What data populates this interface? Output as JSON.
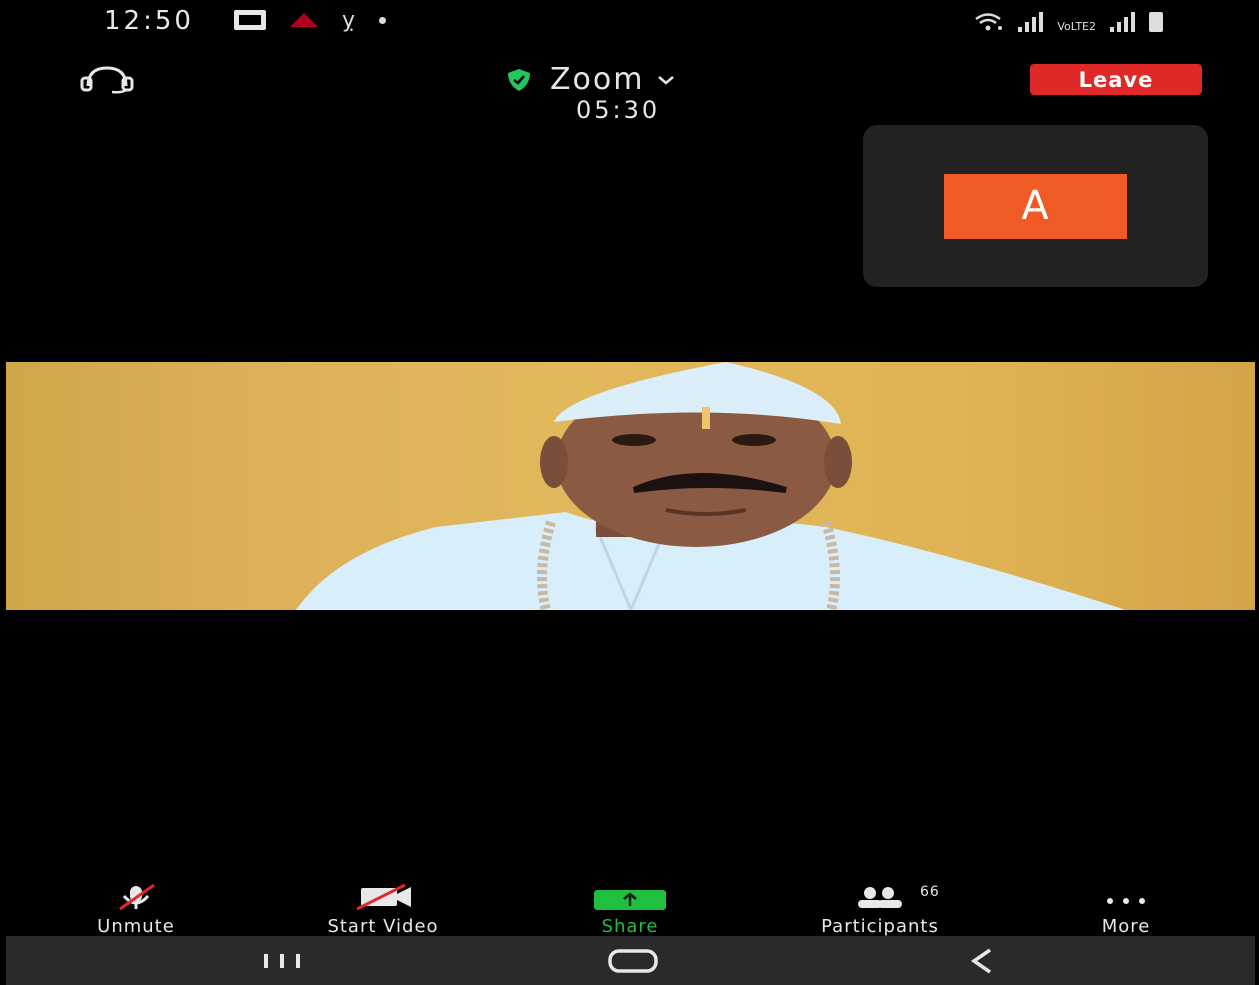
{
  "status_bar": {
    "time": "12:50",
    "network_label": "VoLTE2"
  },
  "header": {
    "meeting_title": "Zoom",
    "timer": "05:30",
    "leave_label": "Leave",
    "secure_icon": "shield-check-icon",
    "audio_icon": "headset-icon"
  },
  "self_view": {
    "avatar_initial": "A",
    "avatar_color": "#f05a24"
  },
  "toolbar": {
    "unmute_label": "Unmute",
    "start_video_label": "Start Video",
    "share_label": "Share",
    "participants_label": "Participants",
    "participants_count": "66",
    "more_label": "More",
    "share_color": "#1fbf3f",
    "muted_slash_color": "#e02828"
  },
  "colors": {
    "leave": "#e02828",
    "background": "#000000",
    "nav": "#2a2a2a"
  }
}
